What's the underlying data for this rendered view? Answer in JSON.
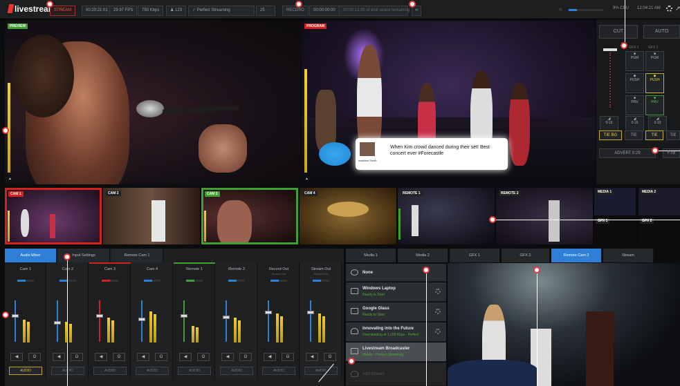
{
  "topbar": {
    "logo": "livestream",
    "stream_label": "STREAM",
    "stream_time": "00:20:21:01",
    "fps": "29.97 FPS",
    "bitrate": "750 Kbps",
    "viewers": "123",
    "streaming_status": "Perfect Streaming",
    "count": "25",
    "record_label": "RECORD",
    "record_time": "00:00:00:00",
    "disk_status": "00:00:13:35 of disk space remaining",
    "cpu": "9% CPU",
    "clock": "12:04:21 AM"
  },
  "preview": {
    "tag": "PREVIEW"
  },
  "program": {
    "tag": "PROGRAM",
    "tweet_text": "When Kim crowd danced during their set! Best concert ever #Forecastle",
    "tweet_user": "matthew Smith"
  },
  "control": {
    "cut": "CUT",
    "auto": "AUTO",
    "gfx1": "GFX 1",
    "gfx2": "GFX 2",
    "pgm": "PGM",
    "push": "PUSH",
    "prv": "PRV",
    "dur": "0:15",
    "tie_bg": "TIE BG",
    "tie": "TIE",
    "advert": "ADVERT 0:29",
    "ftb": "FTB"
  },
  "multiview": [
    {
      "label": "CAM 1",
      "state": "program"
    },
    {
      "label": "CAM 2",
      "state": "none"
    },
    {
      "label": "CAM 3",
      "state": "preview"
    },
    {
      "label": "CAM 4",
      "state": "none"
    },
    {
      "label": "REMOTE 1",
      "state": "none"
    },
    {
      "label": "REMOTE 2",
      "state": "none"
    },
    {
      "label": "MEDIA 1",
      "state": "none"
    },
    {
      "label": "MEDIA 2",
      "state": "none"
    },
    {
      "label": "GFX 1",
      "state": "none"
    },
    {
      "label": "GFX 2",
      "state": "none"
    }
  ],
  "left_tabs": [
    "Audio Mixer",
    "Input Settings",
    "Remote Cam 1"
  ],
  "mixer": {
    "strips": [
      {
        "name": "Cam 1",
        "sub": ""
      },
      {
        "name": "Cam 2",
        "sub": ""
      },
      {
        "name": "Cam 3",
        "sub": ""
      },
      {
        "name": "Cam 4",
        "sub": ""
      },
      {
        "name": "Remote 1",
        "sub": ""
      },
      {
        "name": "Remote 2",
        "sub": ""
      },
      {
        "name": "Record Out",
        "sub": "Stream Out"
      },
      {
        "name": "Stream Out",
        "sub": "Record Out"
      }
    ],
    "audio_label": "AUDIO"
  },
  "right_tabs": [
    "Media 1",
    "Media 2",
    "GFX 1",
    "GFX 2",
    "Remote Cam 2",
    "Stream"
  ],
  "media": [
    {
      "title": "None",
      "status": ""
    },
    {
      "title": "Windows Laptop",
      "status": "Ready to Start"
    },
    {
      "title": "Google Glass",
      "status": "Ready to Start"
    },
    {
      "title": "Innovating into the Future",
      "status": "Downloading at 1,200 Kbps - Perfect"
    },
    {
      "title": "Livestream Broadcaster",
      "status": "Mobile - Perfect Streaming"
    },
    {
      "title": "Add Stream",
      "status": ""
    }
  ],
  "colors": {
    "program": "#d32020",
    "preview": "#3fa034",
    "accent": "#2f7fd6",
    "callout": "#e43c3c"
  }
}
